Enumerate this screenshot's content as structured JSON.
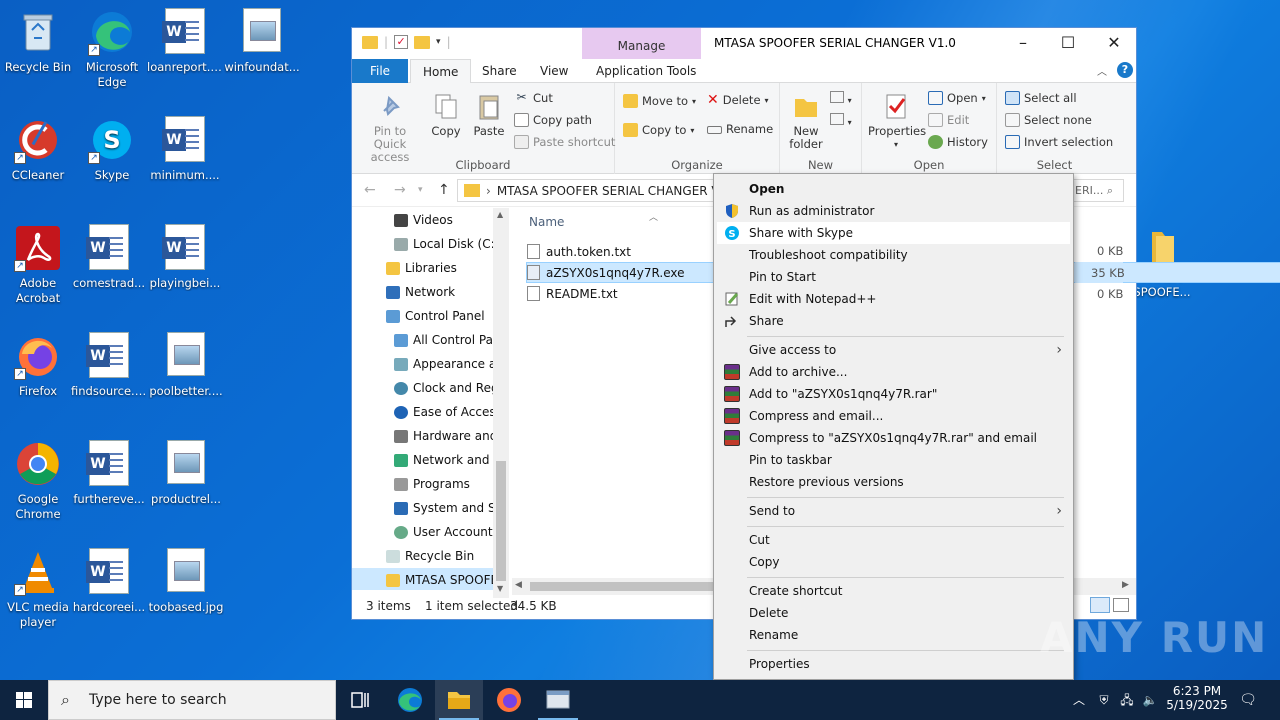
{
  "desktop": {
    "icons": [
      {
        "label": "Recycle Bin"
      },
      {
        "label": "Microsoft Edge"
      },
      {
        "label": "loanreport.rtf"
      },
      {
        "label": "winfoundat..."
      },
      {
        "label": "CCleaner"
      },
      {
        "label": "Skype"
      },
      {
        "label": "minimum...."
      },
      {
        "label": "Adobe Acrobat"
      },
      {
        "label": "comestrad..."
      },
      {
        "label": "playingbei..."
      },
      {
        "label": "Firefox"
      },
      {
        "label": "findsource.rtf"
      },
      {
        "label": "poolbetter...."
      },
      {
        "label": "Google Chrome"
      },
      {
        "label": "furthereve..."
      },
      {
        "label": "productrel..."
      },
      {
        "label": "VLC media player"
      },
      {
        "label": "hardcoreei..."
      },
      {
        "label": "toobased.jpg"
      }
    ],
    "right_folder": {
      "label": "MTASA SPOOFE..."
    }
  },
  "explorer": {
    "title": "MTASA SPOOFER  SERIAL CHANGER V1.0",
    "manage_tab": "Manage",
    "tabs": {
      "file": "File",
      "home": "Home",
      "share": "Share",
      "view": "View",
      "app_tools": "Application Tools"
    },
    "ribbon": {
      "clipboard": {
        "pin": "Pin to Quick access",
        "copy": "Copy",
        "paste": "Paste",
        "cut": "Cut",
        "copy_path": "Copy path",
        "paste_shortcut": "Paste shortcut",
        "label": "Clipboard"
      },
      "organize": {
        "move_to": "Move to",
        "delete": "Delete",
        "copy_to": "Copy to",
        "rename": "Rename",
        "label": "Organize"
      },
      "new": {
        "new_folder": "New folder",
        "label": "New"
      },
      "open": {
        "properties": "Properties",
        "open": "Open",
        "edit": "Edit",
        "history": "History",
        "label": "Open"
      },
      "select": {
        "select_all": "Select all",
        "select_none": "Select none",
        "invert": "Invert selection",
        "label": "Select"
      }
    },
    "address": "MTASA SPOOFER  SERIAL CHANGER V1.0",
    "search_placeholder": "ERI...",
    "nav": [
      "Videos",
      "Local Disk (C:)",
      "Libraries",
      "Network",
      "Control Panel",
      "All Control Par",
      "Appearance an",
      "Clock and Regi",
      "Ease of Access",
      "Hardware and",
      "Network and Ir",
      "Programs",
      "System and Sec",
      "User Accounts",
      "Recycle Bin",
      "MTASA SPOOFER"
    ],
    "column_name": "Name",
    "files": [
      {
        "name": "auth.token.txt",
        "size": "0 KB"
      },
      {
        "name": "aZSYX0s1qnq4y7R.exe",
        "size": "35 KB"
      },
      {
        "name": "README.txt",
        "size": "0 KB"
      }
    ],
    "status": {
      "count": "3 items",
      "selected": "1 item selected",
      "size": "34.5 KB"
    }
  },
  "context_menu": {
    "items": [
      "Open",
      "Run as administrator",
      "Share with Skype",
      "Troubleshoot compatibility",
      "Pin to Start",
      "Edit with Notepad++",
      "Share",
      "Give access to",
      "Add to archive...",
      "Add to \"aZSYX0s1qnq4y7R.rar\"",
      "Compress and email...",
      "Compress to \"aZSYX0s1qnq4y7R.rar\" and email",
      "Pin to taskbar",
      "Restore previous versions",
      "Send to",
      "Cut",
      "Copy",
      "Create shortcut",
      "Delete",
      "Rename",
      "Properties"
    ]
  },
  "watermark": "ANY RUN",
  "taskbar": {
    "search_placeholder": "Type here to search",
    "time": "6:23 PM",
    "date": "5/19/2025"
  },
  "colors": {
    "accent": "#1979ca",
    "selection": "#cce8ff",
    "manage": "#e7c9f0",
    "taskbar": "#0e2440"
  }
}
